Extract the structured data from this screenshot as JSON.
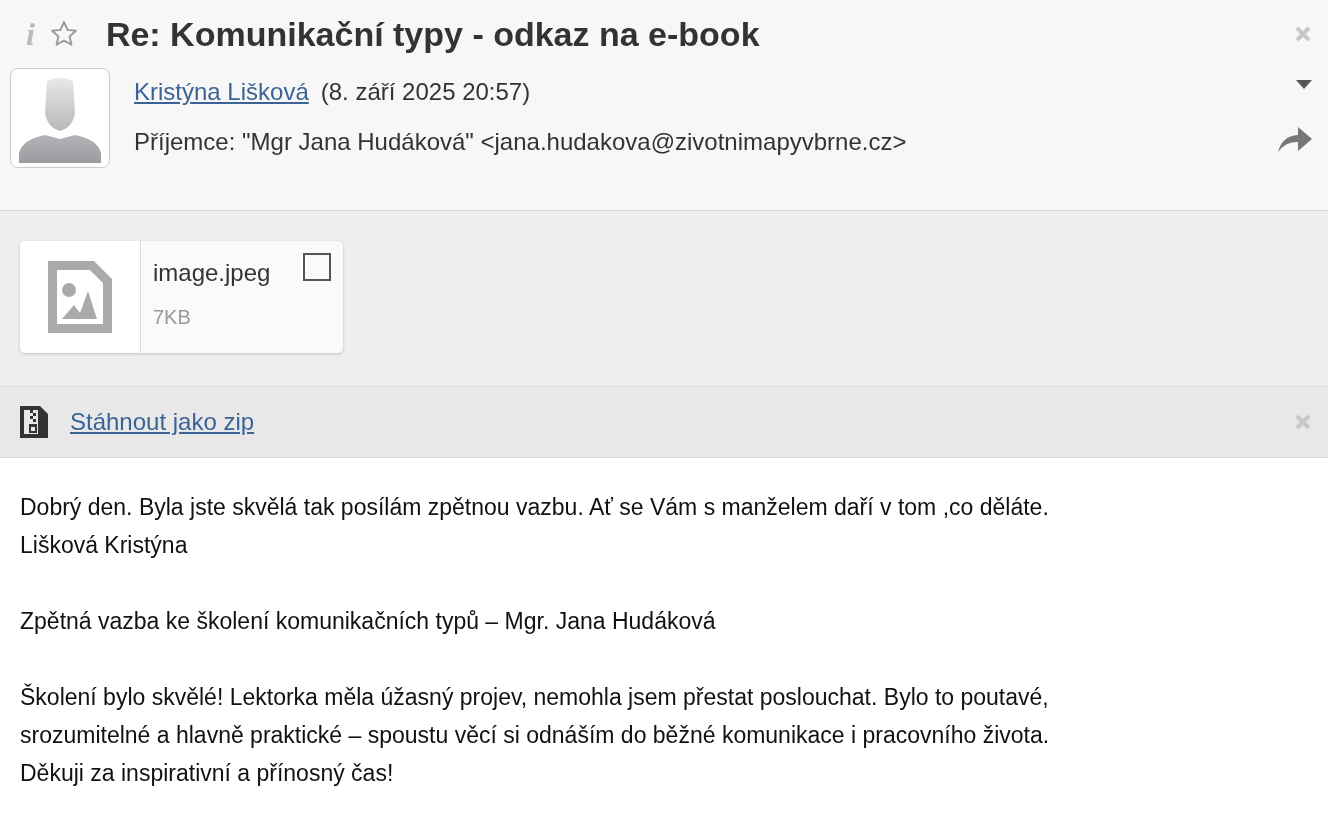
{
  "message": {
    "subject": "Re: Komunikační typy - odkaz na e-book",
    "info_icon": "i",
    "starred": false,
    "sender": {
      "name": "Kristýna Lišková",
      "date": "(8. září 2025 20:57)"
    },
    "recipients": "Příjemce: \"Mgr Jana Hudáková\" <jana.hudakova@zivotnimapyvbrne.cz>"
  },
  "attachments": [
    {
      "name": "image.jpeg",
      "size": "7KB",
      "checked": false
    }
  ],
  "zip_link": "Stáhnout jako zip",
  "body": [
    [
      "Dobrý den. Byla jste skvělá tak posílám zpětnou vazbu. Ať se Vám s manželem daří v tom ,co děláte.",
      "Lišková Kristýna"
    ],
    [
      "Zpětná vazba ke školení komunikačních typů – Mgr. Jana Hudáková"
    ],
    [
      "Školení bylo skvělé! Lektorka měla úžasný projev, nemohla jsem přestat poslouchat. Bylo to poutavé,",
      "srozumitelné a hlavně praktické – spoustu věcí si odnáším do běžné komunikace i pracovního života.",
      "Děkuji za inspirativní a přínosný čas!"
    ]
  ]
}
